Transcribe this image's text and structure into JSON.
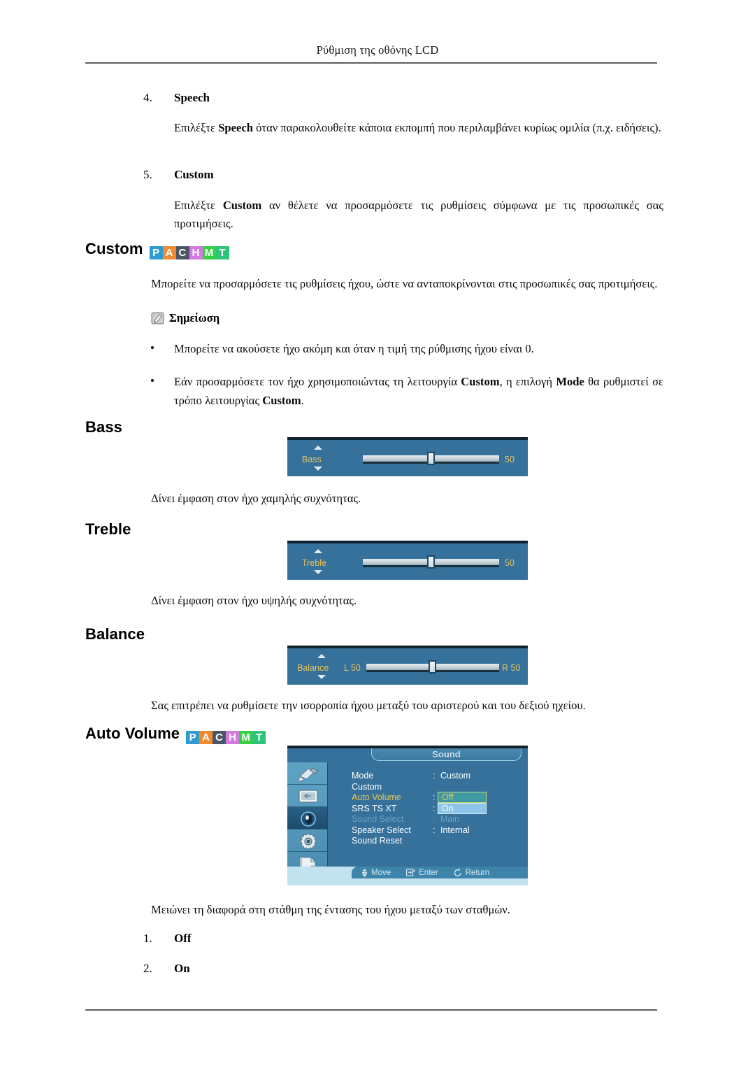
{
  "header": {
    "title": "Ρύθμιση της οθόνης LCD"
  },
  "items": [
    {
      "number": "4.",
      "label": "Speech",
      "body_before": "Επιλέξτε ",
      "body_bold": "Speech",
      "body_after": " όταν παρακολουθείτε κάποια εκπομπή που περιλαμβάνει κυρίως ομιλία (π.χ. ειδήσεις)."
    },
    {
      "number": "5.",
      "label": "Custom",
      "body_before": "Επιλέξτε ",
      "body_bold": "Custom",
      "body_after": " αν θέλετε να προσαρμόσετε τις ρυθμίσεις σύμφωνα με τις προσωπικές σας προτιμήσεις."
    }
  ],
  "custom_section": {
    "heading": "Custom",
    "paragraph": "Μπορείτε να προσαρμόσετε τις ρυθμίσεις ήχου, ώστε να ανταποκρίνονται στις προσωπικές σας προτιμήσεις.",
    "note_label": "Σημείωση",
    "note_icon": "note-pencil-icon",
    "bullets": [
      {
        "text_before": "Μπορείτε να ακούσετε ήχο ακόμη και όταν η τιμή της ρύθμισης ήχου είναι 0.",
        "bold1": "",
        "text_mid": "",
        "bold2": "",
        "text_after": ""
      },
      {
        "text_before": "Εάν προσαρμόσετε τον ήχο χρησιμοποιώντας τη λειτουργία ",
        "bold1": "Custom",
        "text_mid": ", η επιλογή ",
        "bold2": "Mode",
        "text_after": " θα ρυθμιστεί σε τρόπο λειτουργίας ",
        "bold3": "Custom",
        "text_end": "."
      }
    ]
  },
  "badges": {
    "letters": [
      "P",
      "A",
      "C",
      "H",
      "M",
      "T"
    ],
    "colors": [
      "#2f9bd0",
      "#f08a2e",
      "#4c5766",
      "#d579e0",
      "#35d145",
      "#2fc47a"
    ]
  },
  "bass_section": {
    "heading": "Bass",
    "description": "Δίνει έμφαση στον ήχο χαμηλής συχνότητας.",
    "osd": {
      "label": "Bass",
      "value": "50",
      "thumb_percent": 50
    }
  },
  "treble_section": {
    "heading": "Treble",
    "description": "Δίνει έμφαση στον ήχο υψηλής συχνότητας.",
    "osd": {
      "label": "Treble",
      "value": "50",
      "thumb_percent": 50
    }
  },
  "balance_section": {
    "heading": "Balance",
    "description": "Σας επιτρέπει να ρυθμίσετε την ισορροπία ήχου μεταξύ του αριστερού και του δεξιού ηχείου.",
    "osd": {
      "label": "Balance",
      "left_label": "L  50",
      "right_label": "R  50",
      "thumb_percent": 50
    }
  },
  "auto_volume_section": {
    "heading": "Auto Volume",
    "description": "Μειώνει τη διαφορά στη στάθμη της έντασης του ήχου μεταξύ των σταθμών.",
    "options": [
      {
        "number": "1.",
        "label": "Off"
      },
      {
        "number": "2.",
        "label": "On"
      }
    ],
    "osd_menu": {
      "title": "Sound",
      "sidebar_icons": [
        "picture-brush-icon",
        "screen-icon",
        "sound-speaker-icon",
        "setup-gear-icon",
        "multi-control-icon"
      ],
      "selected_sidebar_index": 2,
      "rows": [
        {
          "name": "Mode",
          "colon": ":",
          "value": "Custom",
          "state": "normal"
        },
        {
          "name": "Custom",
          "colon": "",
          "value": "",
          "state": "normal"
        },
        {
          "name": "Auto Volume",
          "colon": ":",
          "value": "",
          "state": "active"
        },
        {
          "name": "SRS TS XT",
          "colon": ":",
          "value": "",
          "state": "normal"
        },
        {
          "name": "Sound Select",
          "colon": ":",
          "value": "Main",
          "state": "dim"
        },
        {
          "name": "Speaker Select",
          "colon": ":",
          "value": "Internal",
          "state": "normal"
        },
        {
          "name": "Sound Reset",
          "colon": "",
          "value": "",
          "state": "normal"
        }
      ],
      "popup": {
        "off_label": "Off",
        "on_label": "On"
      },
      "footer": [
        {
          "icon": "move-updown-icon",
          "label": "Move"
        },
        {
          "icon": "enter-icon",
          "label": "Enter"
        },
        {
          "icon": "return-icon",
          "label": "Return"
        }
      ]
    }
  }
}
